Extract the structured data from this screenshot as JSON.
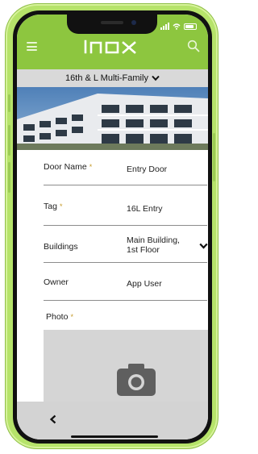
{
  "app": {
    "logo_text": "Inox",
    "brand_color": "#8dc63f",
    "menu_icon": "hamburger-menu-icon",
    "search_icon": "search-icon"
  },
  "site_selector": {
    "selected": "16th & L Multi-Family",
    "icon": "chevron-down-icon"
  },
  "form": {
    "door_name": {
      "label": "Door Name",
      "required_mark": "*",
      "value": "Entry Door"
    },
    "tag": {
      "label": "Tag",
      "required_mark": "*",
      "value": "16L Entry"
    },
    "buildings": {
      "label": "Buildings",
      "value_line1": "Main Building,",
      "value_line2": "1st Floor",
      "icon": "chevron-down-icon"
    },
    "owner": {
      "label": "Owner",
      "value": "App User"
    },
    "photo": {
      "label": "Photo",
      "required_mark": "*",
      "icon": "camera-icon"
    }
  },
  "bottom_bar": {
    "back_icon": "back-chevron-icon"
  }
}
